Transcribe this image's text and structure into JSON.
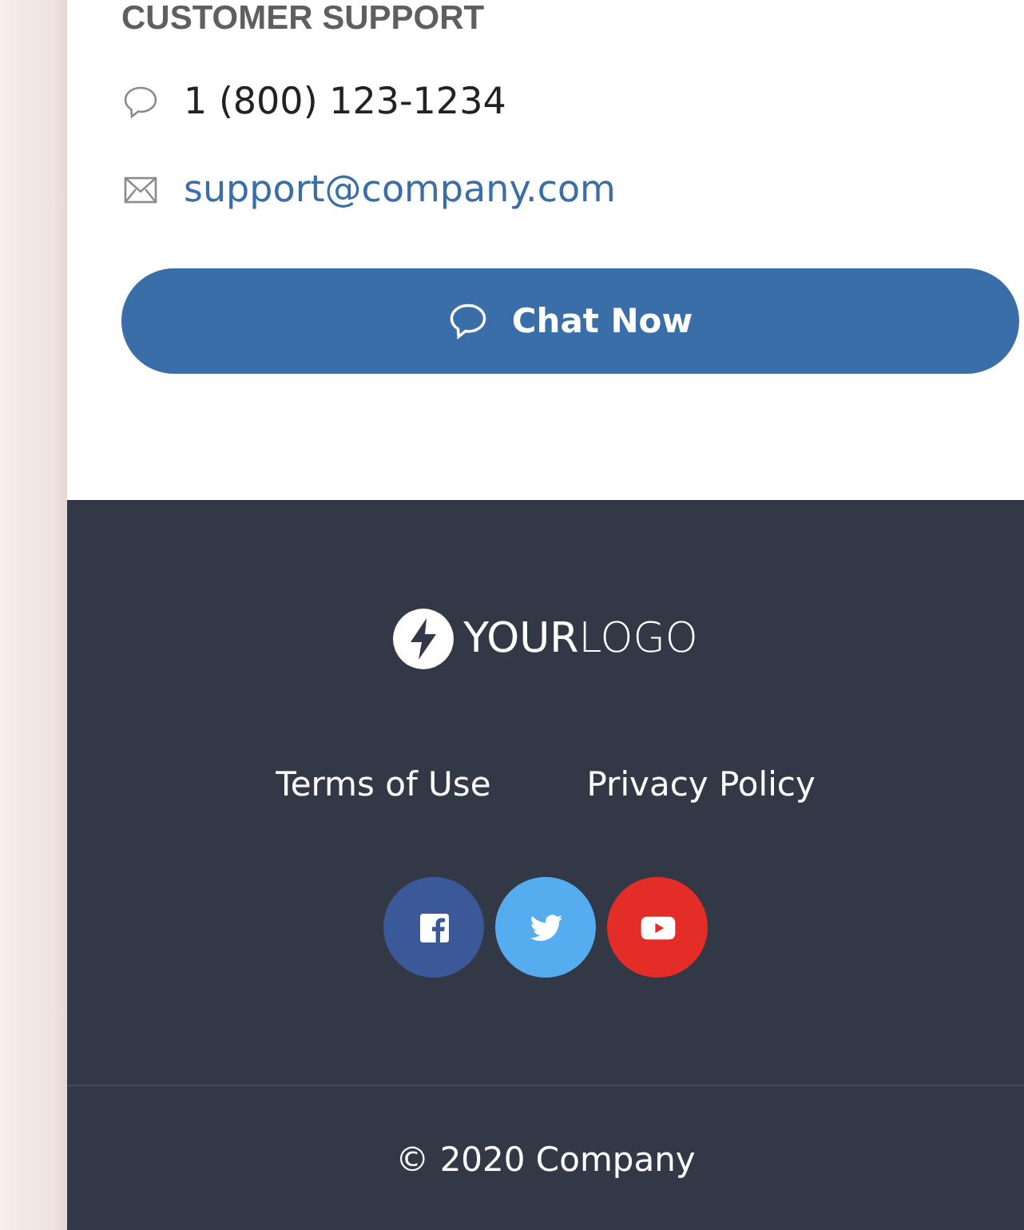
{
  "support": {
    "heading": "CUSTOMER SUPPORT",
    "phone": "1 (800) 123-1234",
    "email": "support@company.com",
    "chat_button": "Chat Now"
  },
  "footer": {
    "logo": "**YOUR**LOGO",
    "links": [
      "Terms of Use",
      "Privacy Policy"
    ],
    "social": [
      {
        "kind": "facebook",
        "color": "#3b5998"
      },
      {
        "kind": "twitter",
        "color": "#55acee"
      },
      {
        "kind": "youtube",
        "color": "#e52d27"
      }
    ],
    "copyright": "© 2020 Company"
  }
}
